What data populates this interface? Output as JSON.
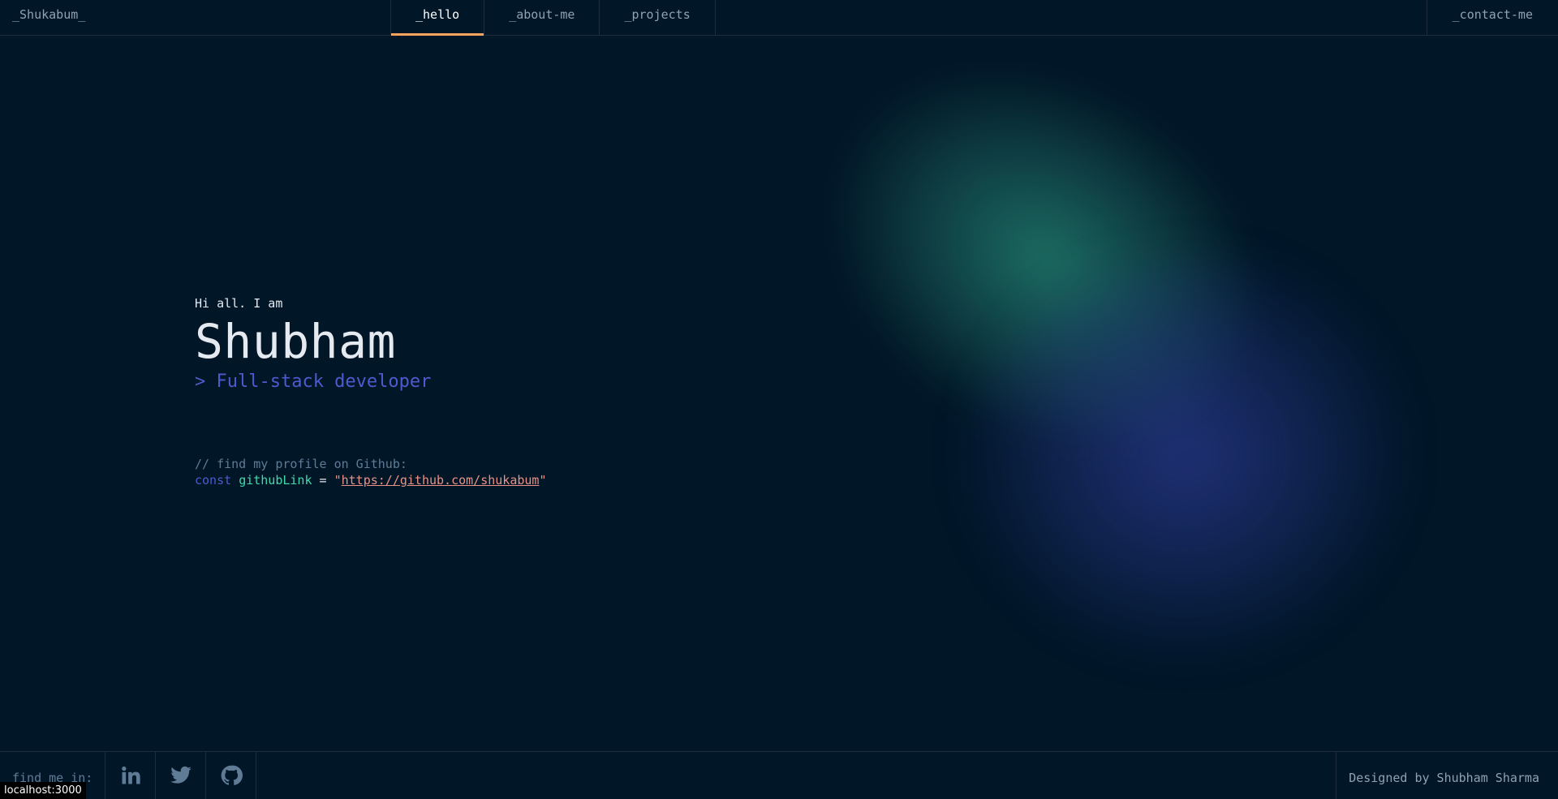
{
  "header": {
    "brand": "_Shukabum_",
    "nav": [
      {
        "label": "_hello",
        "active": true
      },
      {
        "label": "_about-me",
        "active": false
      },
      {
        "label": "_projects",
        "active": false
      }
    ],
    "contact": "_contact-me"
  },
  "hero": {
    "greeting": "Hi all. I am",
    "name": "Shubham",
    "role": "> Full-stack developer"
  },
  "code": {
    "comment": "// find my profile on Github:",
    "keyword": "const",
    "variable": "githubLink",
    "operator": " = ",
    "quote": "\"",
    "link": "https://github.com/shukabum"
  },
  "footer": {
    "find_label": "find me in:",
    "socials": [
      "linkedin-icon",
      "twitter-icon",
      "github-icon"
    ],
    "credit": "Designed by Shubham Sharma"
  },
  "status_bar": "localhost:3000",
  "colors": {
    "background": "#011627",
    "accent_orange": "#fea55f",
    "accent_blue": "#4d5bce",
    "accent_green": "#43d9ad",
    "string": "#e99287"
  }
}
